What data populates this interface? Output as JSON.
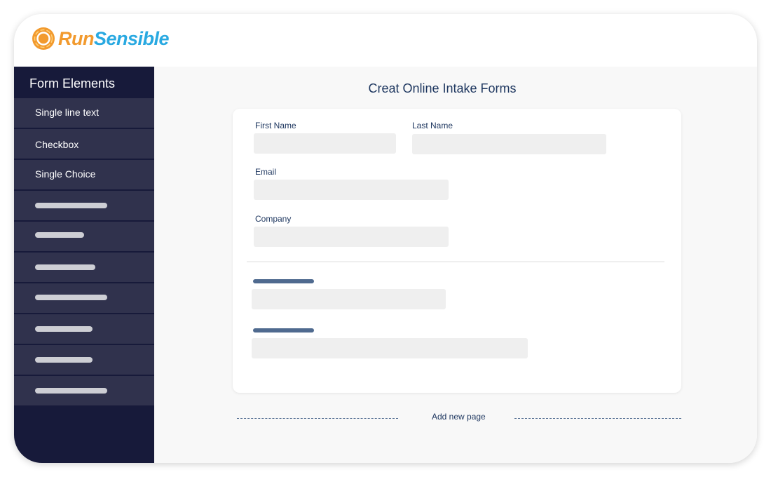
{
  "brand": {
    "name_part1": "Run",
    "name_part2": "Sensible",
    "icon": "sun-ring-logo-icon",
    "colors": {
      "orange": "#f29a2e",
      "blue": "#29a9e1"
    }
  },
  "sidebar": {
    "title": "Form Elements",
    "items": [
      {
        "label": "Single line text"
      },
      {
        "label": "Checkbox"
      },
      {
        "label": "Single Choice"
      },
      {
        "label": ""
      },
      {
        "label": ""
      },
      {
        "label": ""
      },
      {
        "label": ""
      },
      {
        "label": ""
      },
      {
        "label": ""
      },
      {
        "label": ""
      }
    ]
  },
  "main": {
    "title": "Creat Online Intake Forms",
    "form": {
      "fields": [
        {
          "label": "First Name",
          "value": ""
        },
        {
          "label": "Last Name",
          "value": ""
        },
        {
          "label": "Email",
          "value": ""
        },
        {
          "label": "Company",
          "value": ""
        }
      ]
    },
    "add_page_label": "Add new page"
  },
  "colors": {
    "sidebar_bg": "#171a3a",
    "sidebar_item_bg": "#30324d",
    "text_navy": "#1c355e",
    "placeholder_bar": "#4f6a8f",
    "field_bg": "#efefef"
  }
}
